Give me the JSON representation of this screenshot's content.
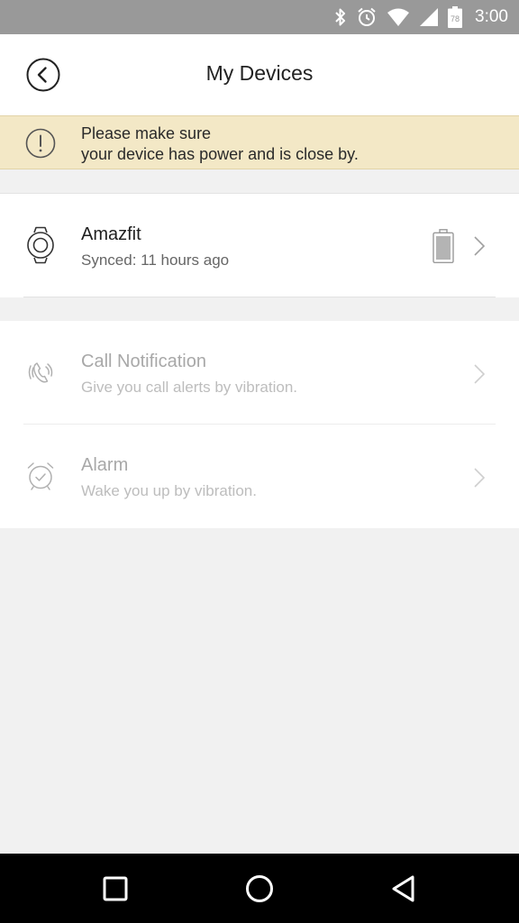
{
  "status_bar": {
    "time": "3:00",
    "battery_level": "78"
  },
  "header": {
    "title": "My Devices"
  },
  "warning": {
    "line1": "Please make sure",
    "line2": "your device has power and is close by."
  },
  "device": {
    "name": "Amazfit",
    "sync_status": "Synced: 11 hours ago"
  },
  "settings": [
    {
      "title": "Call Notification",
      "description": "Give you call alerts by vibration.",
      "icon": "phone-vibrate-icon"
    },
    {
      "title": "Alarm",
      "description": "Wake you up by vibration.",
      "icon": "alarm-clock-icon"
    }
  ],
  "colors": {
    "status_bar": "#999999",
    "banner": "#f3e8c6",
    "background": "#f1f1f1",
    "disabled_text": "#a8a8a8"
  }
}
